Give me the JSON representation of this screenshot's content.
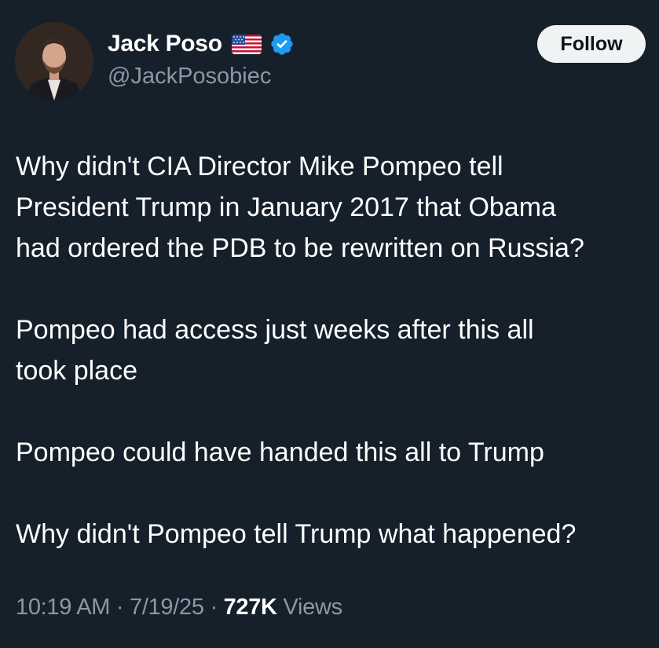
{
  "author": {
    "display_name": "Jack Poso",
    "handle": "@JackPosobiec",
    "flag_icon": "us-flag-icon",
    "verified_icon": "verified-badge-icon",
    "verified_color": "#1d9bf0"
  },
  "follow_button": {
    "label": "Follow"
  },
  "tweet": {
    "paragraphs": [
      "Why didn't CIA Director Mike Pompeo tell\nPresident Trump in January 2017 that Obama\nhad ordered the PDB to be rewritten on Russia?",
      "Pompeo had access just weeks after this all\ntook place",
      "Pompeo could have handed this all to Trump",
      "Why didn't Pompeo tell Trump what happened?"
    ]
  },
  "meta": {
    "time": "10:19 AM",
    "separator": " · ",
    "date": "7/19/25",
    "views_count": "727K",
    "views_label": " Views"
  },
  "colors": {
    "background": "#15202b",
    "text_primary": "#ffffff",
    "text_secondary": "#8b98a5",
    "button_bg": "#eff3f4",
    "button_text": "#0f1419"
  }
}
